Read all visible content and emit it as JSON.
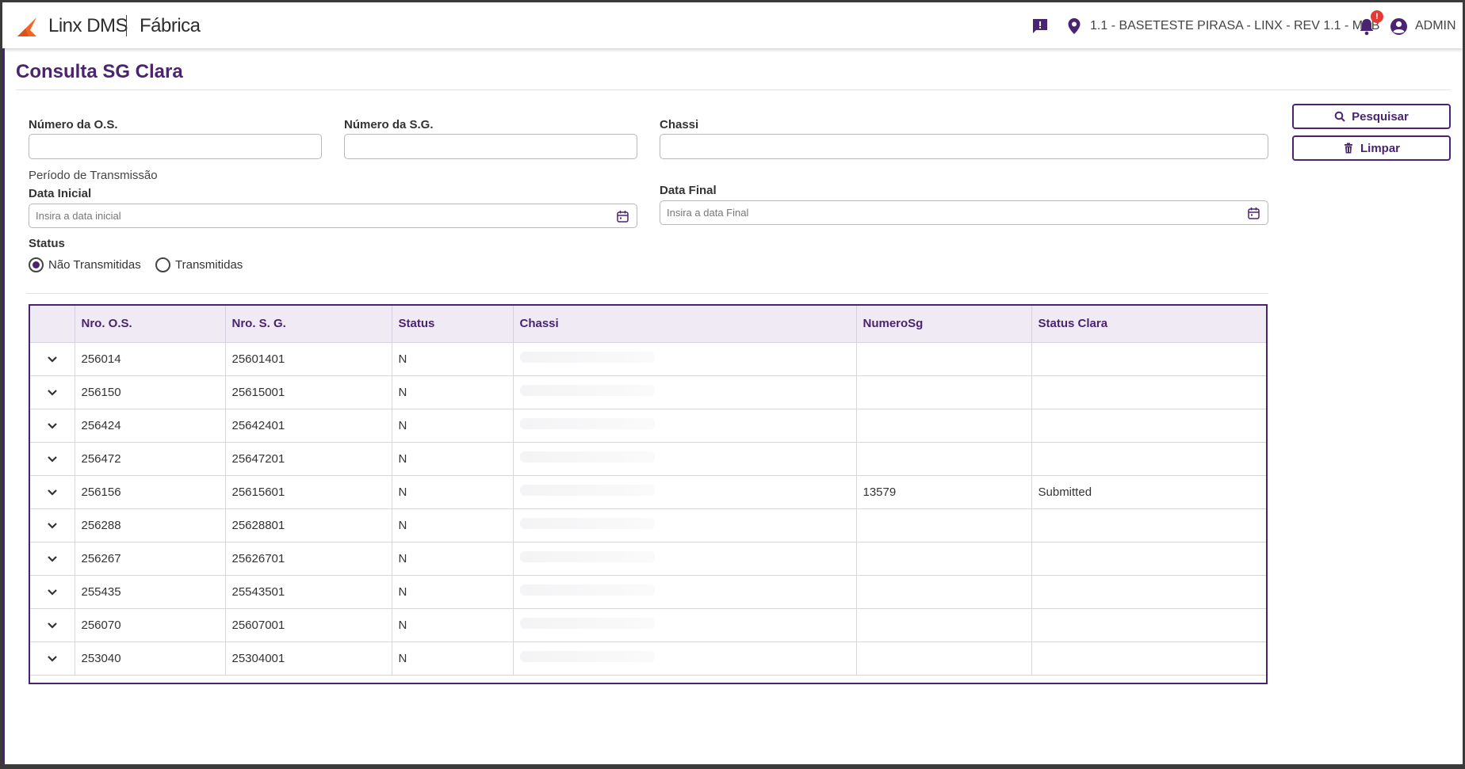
{
  "header": {
    "brand": "Linx DMS",
    "module": "Fábrica",
    "location": "1.1 - BASETESTE PIRASA - LINX - REV 1.1 - MBB",
    "notification_badge": "!",
    "user": "ADMIN"
  },
  "page": {
    "title": "Consulta SG Clara"
  },
  "form": {
    "os_label": "Número da O.S.",
    "os_value": "",
    "sg_label": "Número da S.G.",
    "sg_value": "",
    "chassi_label": "Chassi",
    "chassi_value": "",
    "period_label": "Período de Transmissão",
    "start_label": "Data Inicial",
    "start_placeholder": "Insira a data inicial",
    "end_label": "Data Final",
    "end_placeholder": "Insira a data Final",
    "status_label": "Status",
    "status_options": [
      "Não Transmitidas",
      "Transmitidas"
    ],
    "status_selected": "Não Transmitidas"
  },
  "actions": {
    "search_label": "Pesquisar",
    "clear_label": "Limpar"
  },
  "table": {
    "columns": [
      "",
      "Nro. O.S.",
      "Nro. S. G.",
      "Status",
      "Chassi",
      "NumeroSg",
      "Status Clara"
    ],
    "rows": [
      {
        "os": "256014",
        "sg": "25601401",
        "status": "N",
        "chassi": "",
        "numero_sg": "",
        "status_clara": ""
      },
      {
        "os": "256150",
        "sg": "25615001",
        "status": "N",
        "chassi": "",
        "numero_sg": "",
        "status_clara": ""
      },
      {
        "os": "256424",
        "sg": "25642401",
        "status": "N",
        "chassi": "",
        "numero_sg": "",
        "status_clara": ""
      },
      {
        "os": "256472",
        "sg": "25647201",
        "status": "N",
        "chassi": "",
        "numero_sg": "",
        "status_clara": ""
      },
      {
        "os": "256156",
        "sg": "25615601",
        "status": "N",
        "chassi": "",
        "numero_sg": "13579",
        "status_clara": "Submitted"
      },
      {
        "os": "256288",
        "sg": "25628801",
        "status": "N",
        "chassi": "",
        "numero_sg": "",
        "status_clara": ""
      },
      {
        "os": "256267",
        "sg": "25626701",
        "status": "N",
        "chassi": "",
        "numero_sg": "",
        "status_clara": ""
      },
      {
        "os": "255435",
        "sg": "25543501",
        "status": "N",
        "chassi": "",
        "numero_sg": "",
        "status_clara": ""
      },
      {
        "os": "256070",
        "sg": "25607001",
        "status": "N",
        "chassi": "",
        "numero_sg": "",
        "status_clara": ""
      },
      {
        "os": "253040",
        "sg": "25304001",
        "status": "N",
        "chassi": "",
        "numero_sg": "",
        "status_clara": ""
      }
    ]
  },
  "colors": {
    "accent": "#4a2470",
    "logo_orange": "#f26522",
    "badge_red": "#e53935"
  }
}
